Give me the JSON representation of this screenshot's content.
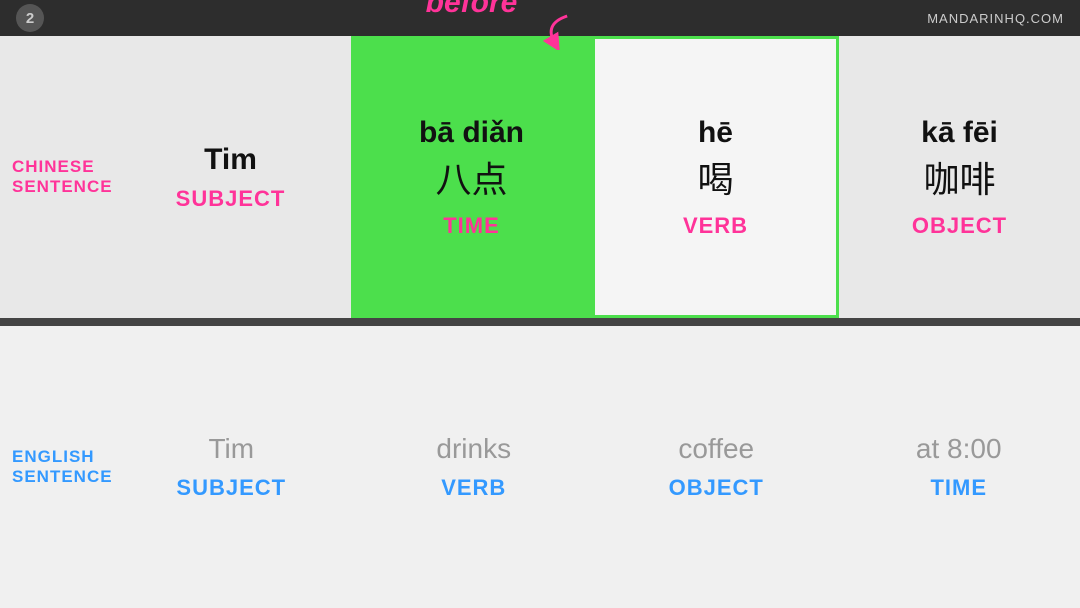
{
  "topbar": {
    "number": "2",
    "brand": "MANDARINHQ.COM"
  },
  "annotation": {
    "before_label": "before"
  },
  "chinese_section": {
    "label_line1": "CHINESE",
    "label_line2": "SENTENCE",
    "cells": [
      {
        "id": "subject",
        "main_text": "Tim",
        "char_text": "",
        "role": "SUBJECT",
        "style": "normal"
      },
      {
        "id": "time",
        "main_text": "bā diǎn",
        "char_text": "八点",
        "role": "TIME",
        "style": "highlighted"
      },
      {
        "id": "verb",
        "main_text": "hē",
        "char_text": "喝",
        "role": "VERB",
        "style": "outlined"
      },
      {
        "id": "object",
        "main_text": "kā fēi",
        "char_text": "咖啡",
        "role": "OBJECT",
        "style": "normal"
      }
    ]
  },
  "english_section": {
    "label_line1": "ENGLISH",
    "label_line2": "SENTENCE",
    "cells": [
      {
        "id": "subject",
        "text": "Tim",
        "role": "SUBJECT"
      },
      {
        "id": "verb",
        "text": "drinks",
        "role": "VERB"
      },
      {
        "id": "object",
        "text": "coffee",
        "role": "OBJECT"
      },
      {
        "id": "time",
        "text": "at 8:00",
        "role": "TIME"
      }
    ]
  }
}
